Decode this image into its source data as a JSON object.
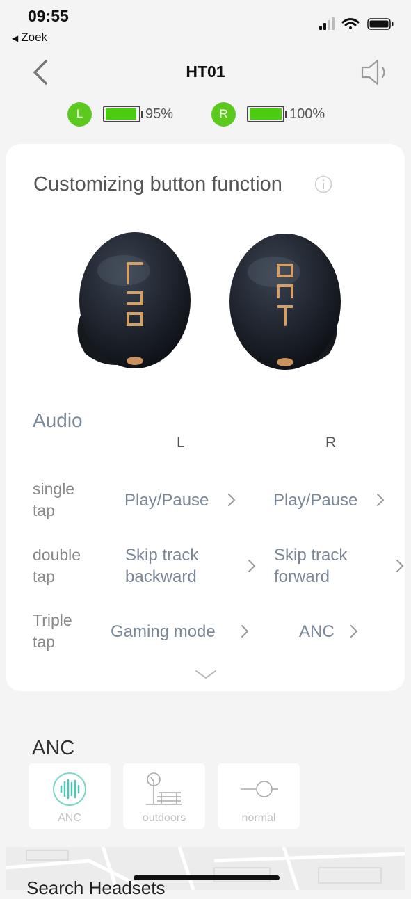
{
  "status": {
    "time": "09:55",
    "back_app": "Zoek"
  },
  "header": {
    "title": "HT01"
  },
  "battery": {
    "left": {
      "label": "L",
      "percent": "95%",
      "level": 0.95
    },
    "right": {
      "label": "R",
      "percent": "100%",
      "level": 1.0
    }
  },
  "card": {
    "title": "Customizing button function",
    "section": "Audio",
    "col_left": "L",
    "col_right": "R",
    "rows": [
      {
        "label": "single\ntap",
        "left": "Play/Pause",
        "right": "Play/Pause"
      },
      {
        "label": "double\ntap",
        "left": "Skip track\nbackward",
        "right": "Skip track\nforward"
      },
      {
        "label": "Triple\ntap",
        "left": "Gaming mode",
        "right": "ANC"
      }
    ]
  },
  "anc": {
    "title": "ANC",
    "modes": [
      {
        "label": "ANC",
        "icon": "waveform-icon",
        "selected": true
      },
      {
        "label": "outdoors",
        "icon": "tree-bench-icon",
        "selected": false
      },
      {
        "label": "normal",
        "icon": "toggle-icon",
        "selected": false
      }
    ]
  },
  "map": {
    "search_text": "Search Headsets"
  },
  "colors": {
    "battery_green": "#5cc91e",
    "accent_teal": "#4fc7b6",
    "value_gray": "#7a8797"
  }
}
